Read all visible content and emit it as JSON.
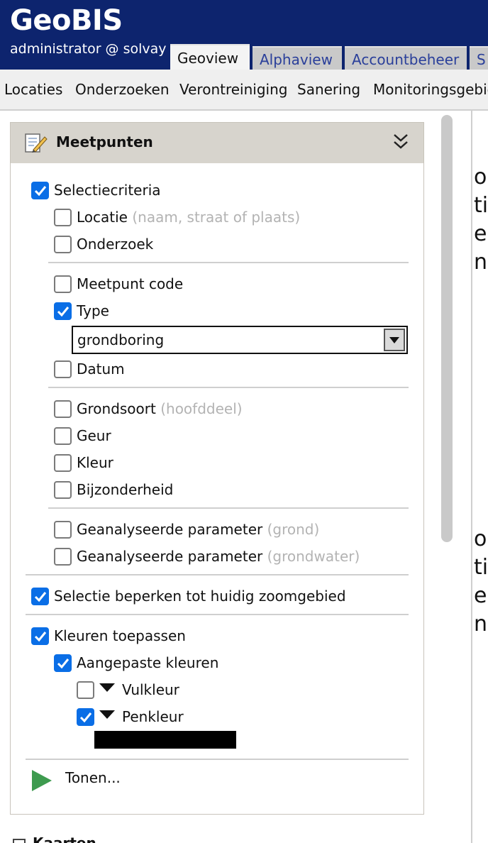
{
  "header": {
    "brand": "GeoBIS",
    "user": "administrator @ solvay",
    "tabs": [
      "Geoview",
      "Alphaview",
      "Accountbeheer",
      "S"
    ]
  },
  "nav": {
    "items": [
      "Locaties",
      "Onderzoeken",
      "Verontreiniging",
      "Sanering",
      "Monitoringsgebied"
    ]
  },
  "panel": {
    "title": "Meetpunten",
    "selectiecriteria": "Selectiecriteria",
    "locatie": "Locatie",
    "locatie_hint": "(naam, straat of plaats)",
    "onderzoek": "Onderzoek",
    "meetpunt_code": "Meetpunt code",
    "type": "Type",
    "type_value": "grondboring",
    "datum": "Datum",
    "grondsoort": "Grondsoort",
    "grondsoort_hint": "(hoofddeel)",
    "geur": "Geur",
    "kleur": "Kleur",
    "bijzonderheid": "Bijzonderheid",
    "param_grond": "Geanalyseerde parameter",
    "param_grond_hint": "(grond)",
    "param_water": "Geanalyseerde parameter",
    "param_water_hint": "(grondwater)",
    "zoom": "Selectie beperken tot huidig zoomgebied",
    "kleuren": "Kleuren toepassen",
    "aangepast": "Aangepaste kleuren",
    "vulkleur": "Vulkleur",
    "penkleur": "Penkleur",
    "tonen": "Tonen..."
  },
  "right_panel": {
    "fragments": [
      "o",
      "ti",
      "e c",
      "ng",
      "o",
      "ti",
      "e c",
      "ng"
    ]
  },
  "bottom": {
    "title": "Kaarten"
  },
  "colors": {
    "header_bg": "#0d246e",
    "checkbox_on": "#0a6ee6",
    "penkleur_swatch": "#000000",
    "play_icon": "#3e9b4f"
  }
}
